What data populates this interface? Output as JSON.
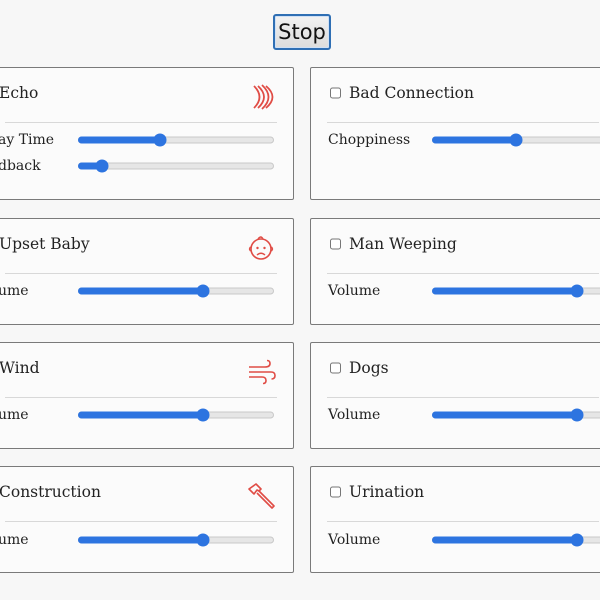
{
  "controls": {
    "stop_label": "Stop"
  },
  "accent_color": "#2d74e0",
  "icon_color": "#e04c45",
  "effects": [
    {
      "name": "Echo",
      "checkbox_visible": false,
      "icon": "echo-waves-icon",
      "params": [
        {
          "label": "Delay Time",
          "shown_text": "ay Time",
          "level": 0.42
        },
        {
          "label": "Feedback",
          "shown_text": "dback",
          "level": 0.12
        }
      ]
    },
    {
      "name": "Bad Connection",
      "checkbox_visible": true,
      "icon": null,
      "params": [
        {
          "label": "Choppiness",
          "shown_text": "Choppiness",
          "level": 0.43
        }
      ]
    },
    {
      "name": "Upset Baby",
      "checkbox_visible": false,
      "icon": "baby-face-icon",
      "params": [
        {
          "label": "Volume",
          "shown_text": "ume",
          "level": 0.64
        }
      ]
    },
    {
      "name": "Man Weeping",
      "checkbox_visible": true,
      "icon": null,
      "params": [
        {
          "label": "Volume",
          "shown_text": "Volume",
          "level": 0.74
        }
      ]
    },
    {
      "name": "Wind",
      "checkbox_visible": false,
      "icon": "wind-icon",
      "params": [
        {
          "label": "Volume",
          "shown_text": "ume",
          "level": 0.64
        }
      ]
    },
    {
      "name": "Dogs",
      "checkbox_visible": true,
      "icon": null,
      "params": [
        {
          "label": "Volume",
          "shown_text": "Volume",
          "level": 0.74
        }
      ]
    },
    {
      "name": "Construction",
      "checkbox_visible": false,
      "icon": "hammer-icon",
      "params": [
        {
          "label": "Volume",
          "shown_text": "ume",
          "level": 0.64
        }
      ]
    },
    {
      "name": "Urination",
      "checkbox_visible": true,
      "icon": null,
      "params": [
        {
          "label": "Volume",
          "shown_text": "Volume",
          "level": 0.74
        }
      ]
    }
  ]
}
